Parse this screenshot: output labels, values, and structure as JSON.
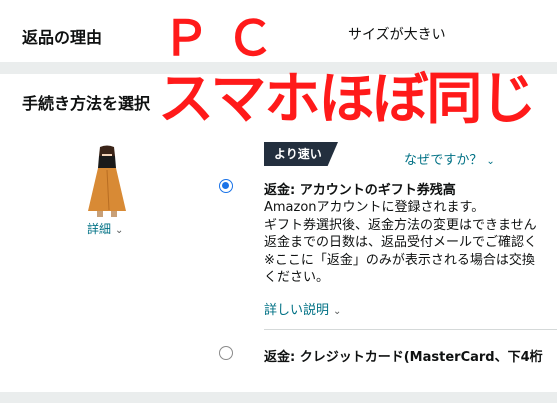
{
  "reason": {
    "label": "返品の理由",
    "value": "サイズが大きい"
  },
  "method": {
    "title": "手続き方法を選択"
  },
  "product": {
    "details_label": "詳細"
  },
  "badge": {
    "label": "より速い"
  },
  "why_link": {
    "label": "なぜですか？"
  },
  "option1": {
    "selected": true,
    "title_prefix": "返金:",
    "title_rest": "アカウントのギフト券残高",
    "lines": [
      "Amazonアカウントに登録されます。",
      "ギフト券選択後、返金方法の変更はできません",
      "返金までの日数は、返品受付メールでご確認く",
      "※ここに「返金」のみが表示される場合は交換",
      "ください。"
    ],
    "more_label": "詳しい説明"
  },
  "option2": {
    "selected": false,
    "title_prefix": "返金:",
    "title_rest": "クレジットカード(MasterCard、下4桁"
  },
  "overlay": {
    "line1": "ＰＣ",
    "line2": "スマホほぼ同じ"
  },
  "colors": {
    "overlay": "#ff1a1a",
    "link": "#007185",
    "badge": "#232f3e",
    "radio": "#1a73e8"
  },
  "icons": {
    "chevron": "chevron-down-icon"
  }
}
